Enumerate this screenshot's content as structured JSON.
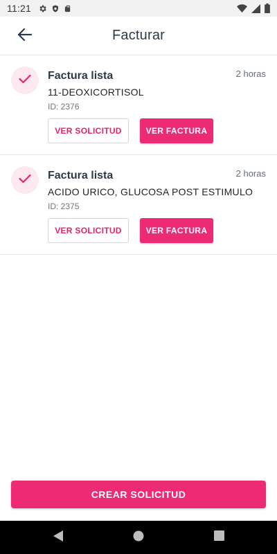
{
  "status_bar": {
    "time": "11:21",
    "left_icons": [
      "gear-icon",
      "shield-icon",
      "sd-card-icon"
    ],
    "right_icons": [
      "wifi-icon",
      "signal-icon",
      "battery-icon"
    ]
  },
  "app_bar": {
    "title": "Facturar",
    "back_icon": "arrow-left-icon"
  },
  "invoices": [
    {
      "status": "Factura lista",
      "description": "11-DEOXICORTISOL",
      "id": "ID: 2376",
      "time": "2 horas",
      "view_request_label": "VER SOLICITUD",
      "view_invoice_label": "VER FACTURA"
    },
    {
      "status": "Factura lista",
      "description": "ACIDO URICO, GLUCOSA POST ESTIMULO",
      "id": "ID: 2375",
      "time": "2 horas",
      "view_request_label": "VER SOLICITUD",
      "view_invoice_label": "VER FACTURA"
    }
  ],
  "footer": {
    "create_label": "CREAR SOLICITUD"
  },
  "nav_bar": {
    "icons": [
      "back-triangle-icon",
      "home-circle-icon",
      "recents-square-icon"
    ]
  },
  "colors": {
    "accent": "#ec2b74",
    "accent_light": "#fde8ef",
    "title_text": "#2b3a4a"
  }
}
